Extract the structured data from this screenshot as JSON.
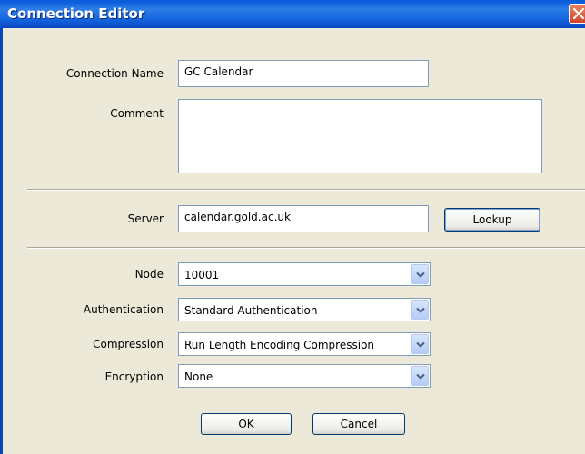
{
  "window": {
    "title": "Connection Editor"
  },
  "form": {
    "connection_name": {
      "label": "Connection Name",
      "value": "GC Calendar"
    },
    "comment": {
      "label": "Comment",
      "value": ""
    },
    "server": {
      "label": "Server",
      "value": "calendar.gold.ac.uk"
    },
    "lookup_label": "Lookup",
    "node": {
      "label": "Node",
      "value": "10001"
    },
    "authentication": {
      "label": "Authentication",
      "value": "Standard Authentication"
    },
    "compression": {
      "label": "Compression",
      "value": "Run Length Encoding Compression"
    },
    "encryption": {
      "label": "Encryption",
      "value": "None"
    }
  },
  "buttons": {
    "ok": "OK",
    "cancel": "Cancel"
  },
  "icons": {
    "close": "close-icon",
    "dropdown": "chevron-down-icon"
  },
  "colors": {
    "titlebar": "#0b5ddc",
    "close": "#d2452a",
    "background": "#ece9d8"
  }
}
